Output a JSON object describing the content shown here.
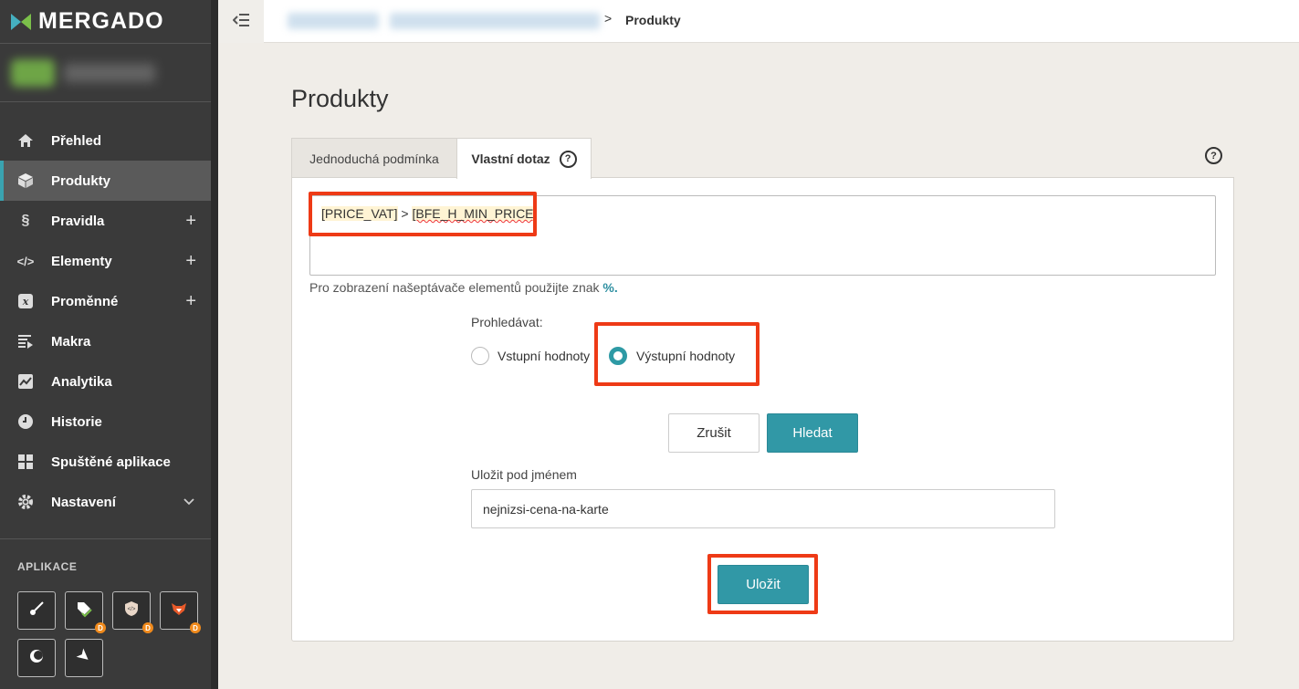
{
  "brand": {
    "name": "MERGADO"
  },
  "sidebar": {
    "items": [
      {
        "label": "Přehled",
        "icon": "home-icon"
      },
      {
        "label": "Produkty",
        "icon": "box-icon"
      },
      {
        "label": "Pravidla",
        "icon": "section-icon"
      },
      {
        "label": "Elementy",
        "icon": "code-icon"
      },
      {
        "label": "Proměnné",
        "icon": "variable-icon"
      },
      {
        "label": "Makra",
        "icon": "macro-icon"
      },
      {
        "label": "Analytika",
        "icon": "chart-icon"
      },
      {
        "label": "Historie",
        "icon": "clock-icon"
      },
      {
        "label": "Spuštěné aplikace",
        "icon": "apps-grid-icon"
      },
      {
        "label": "Nastavení",
        "icon": "gear-icon"
      }
    ],
    "apps_label": "APLIKACE",
    "app_badge": "D"
  },
  "header": {
    "breadcrumb_current": "Produkty",
    "breadcrumb_sep": ">"
  },
  "main": {
    "title": "Produkty",
    "tabs": [
      {
        "label": "Jednoduchá podmínka"
      },
      {
        "label": "Vlastní dotaz"
      }
    ],
    "help_glyph": "?",
    "query": {
      "token1": "[PRICE_VAT]",
      "operator": " > ",
      "token2": "[BFE_H_MIN_PRICE]"
    },
    "hint_text": "Pro zobrazení našeptávače elementů použijte znak ",
    "hint_char": "%.",
    "search_in_label": "Prohledávat:",
    "radio_input_label": "Vstupní hodnoty",
    "radio_output_label": "Výstupní hodnoty",
    "cancel_label": "Zrušit",
    "search_label": "Hledat",
    "save_name_label": "Uložit pod jménem",
    "save_name_value": "nejnizsi-cena-na-karte",
    "save_label": "Uložit"
  },
  "colors": {
    "accent": "#3198a6",
    "highlight": "#ee3a16",
    "sidebar_bg": "#3a3a3a",
    "page_bg": "#f0ede8"
  }
}
